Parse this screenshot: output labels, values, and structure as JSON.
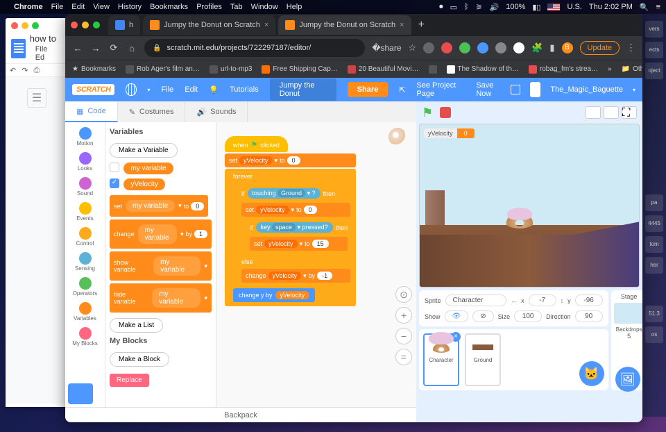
{
  "mac": {
    "app": "Chrome",
    "menus": [
      "File",
      "Edit",
      "View",
      "History",
      "Bookmarks",
      "Profiles",
      "Tab",
      "Window",
      "Help"
    ],
    "battery": "100%",
    "lang": "U.S.",
    "clock": "Thu 2:02 PM"
  },
  "docs": {
    "title": "how to",
    "menus": "File   Ed"
  },
  "chrome": {
    "tabs": [
      {
        "label": "h"
      },
      {
        "label": "Jumpy the Donut on Scratch"
      },
      {
        "label": "Jumpy the Donut on Scratch"
      }
    ],
    "url": "scratch.mit.edu/projects/722297187/editor/",
    "update": "Update",
    "bookmarks": [
      "Bookmarks",
      "Rob Ager's film an…",
      "url-to-mp3",
      "Free Shipping Cap…",
      "20 Beautiful Movi…",
      "The Shadow of th…",
      "robag_fm's strea…"
    ],
    "other": "Other Bookmarks"
  },
  "scratch": {
    "menu": {
      "file": "File",
      "edit": "Edit",
      "tutorials": "Tutorials",
      "title": "Jumpy the Donut",
      "share": "Share",
      "see": "See Project Page",
      "save": "Save Now",
      "user": "The_Magic_Baguette"
    },
    "tabs": {
      "code": "Code",
      "costumes": "Costumes",
      "sounds": "Sounds"
    },
    "cats": [
      "Motion",
      "Looks",
      "Sound",
      "Events",
      "Control",
      "Sensing",
      "Operators",
      "Variables",
      "My Blocks"
    ],
    "catColors": [
      "#4c97ff",
      "#9966ff",
      "#cf63cf",
      "#ffbf00",
      "#ffab19",
      "#5cb1d6",
      "#59c059",
      "#ff8c1a",
      "#ff6680"
    ],
    "palette": {
      "h1": "Variables",
      "make_var": "Make a Variable",
      "myvar": "my variable",
      "yvel": "yVelocity",
      "set": "set",
      "to": "to",
      "zero": "0",
      "change": "change",
      "by": "by",
      "one": "1",
      "show": "show variable",
      "hide": "hide variable",
      "make_list": "Make a List",
      "h2": "My Blocks",
      "make_block": "Make a Block",
      "replace": "Replace"
    },
    "script": {
      "when": "when",
      "clicked": "clicked",
      "set": "set",
      "yvel": "yVelocity",
      "to": "to",
      "zero": "0",
      "forever": "forever",
      "if": "if",
      "then": "then",
      "else": "else",
      "touching": "touching",
      "ground": "Ground",
      "q": "?",
      "key": "key",
      "space": "space",
      "pressed": "pressed?",
      "fifteen": "15",
      "neg1": "-1",
      "change": "change",
      "by": "by",
      "changey": "change y by"
    },
    "monitor": {
      "label": "yVelocity",
      "value": "0"
    },
    "sprite_info": {
      "spriteLbl": "Sprite",
      "sprite": "Character",
      "x": "x",
      "xval": "-7",
      "y": "y",
      "yval": "-96",
      "show": "Show",
      "size": "Size",
      "sizeval": "100",
      "dir": "Direction",
      "dirval": "90"
    },
    "sprites": {
      "char": "Character",
      "ground": "Ground",
      "stage": "Stage",
      "backdrops": "Backdrops",
      "count": "5"
    },
    "backpack": "Backpack"
  },
  "desk": [
    "vers",
    "ects",
    "oject",
    "pa",
    "4445",
    "tom",
    "her",
    "51.3",
    "os"
  ]
}
